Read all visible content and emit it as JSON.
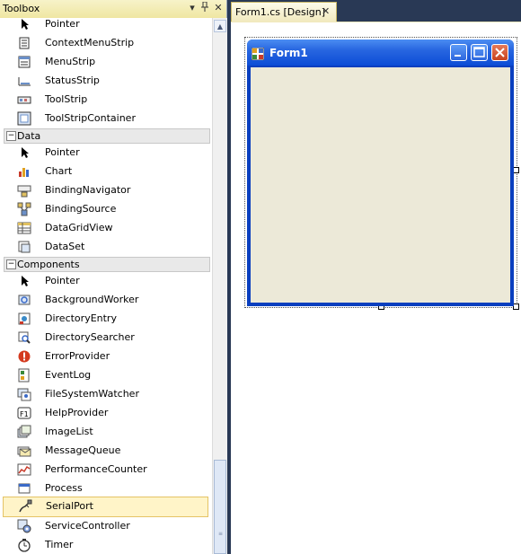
{
  "toolbox": {
    "title": "Toolbox",
    "header_buttons": [
      "dropdown-icon",
      "pin-icon",
      "close-icon"
    ],
    "top_items": [
      {
        "label": "Pointer",
        "icon": "pointer-icon"
      },
      {
        "label": "ContextMenuStrip",
        "icon": "context-menu-strip-icon"
      },
      {
        "label": "MenuStrip",
        "icon": "menu-strip-icon"
      },
      {
        "label": "StatusStrip",
        "icon": "status-strip-icon"
      },
      {
        "label": "ToolStrip",
        "icon": "tool-strip-icon"
      },
      {
        "label": "ToolStripContainer",
        "icon": "tool-strip-container-icon"
      }
    ],
    "categories": [
      {
        "name": "Data",
        "expanded": true,
        "items": [
          {
            "label": "Pointer",
            "icon": "pointer-icon"
          },
          {
            "label": "Chart",
            "icon": "chart-icon"
          },
          {
            "label": "BindingNavigator",
            "icon": "binding-navigator-icon"
          },
          {
            "label": "BindingSource",
            "icon": "binding-source-icon"
          },
          {
            "label": "DataGridView",
            "icon": "data-grid-view-icon"
          },
          {
            "label": "DataSet",
            "icon": "dataset-icon"
          }
        ]
      },
      {
        "name": "Components",
        "expanded": true,
        "items": [
          {
            "label": "Pointer",
            "icon": "pointer-icon"
          },
          {
            "label": "BackgroundWorker",
            "icon": "background-worker-icon"
          },
          {
            "label": "DirectoryEntry",
            "icon": "directory-entry-icon"
          },
          {
            "label": "DirectorySearcher",
            "icon": "directory-searcher-icon"
          },
          {
            "label": "ErrorProvider",
            "icon": "error-provider-icon"
          },
          {
            "label": "EventLog",
            "icon": "event-log-icon"
          },
          {
            "label": "FileSystemWatcher",
            "icon": "file-system-watcher-icon"
          },
          {
            "label": "HelpProvider",
            "icon": "help-provider-icon"
          },
          {
            "label": "ImageList",
            "icon": "image-list-icon"
          },
          {
            "label": "MessageQueue",
            "icon": "message-queue-icon"
          },
          {
            "label": "PerformanceCounter",
            "icon": "performance-counter-icon"
          },
          {
            "label": "Process",
            "icon": "process-icon"
          },
          {
            "label": "SerialPort",
            "icon": "serial-port-icon",
            "selected": true
          },
          {
            "label": "ServiceController",
            "icon": "service-controller-icon"
          },
          {
            "label": "Timer",
            "icon": "timer-icon"
          }
        ]
      }
    ]
  },
  "editor": {
    "tab_label": "Form1.cs [Design]",
    "form": {
      "title": "Form1",
      "caption_buttons": [
        "minimize-icon",
        "maximize-icon",
        "close-icon"
      ],
      "client_color": "#ece9d8"
    }
  },
  "colors": {
    "ide_background": "#293955",
    "selection_background": "#fff4c8",
    "form_title_blue": "#0c4dd6"
  }
}
